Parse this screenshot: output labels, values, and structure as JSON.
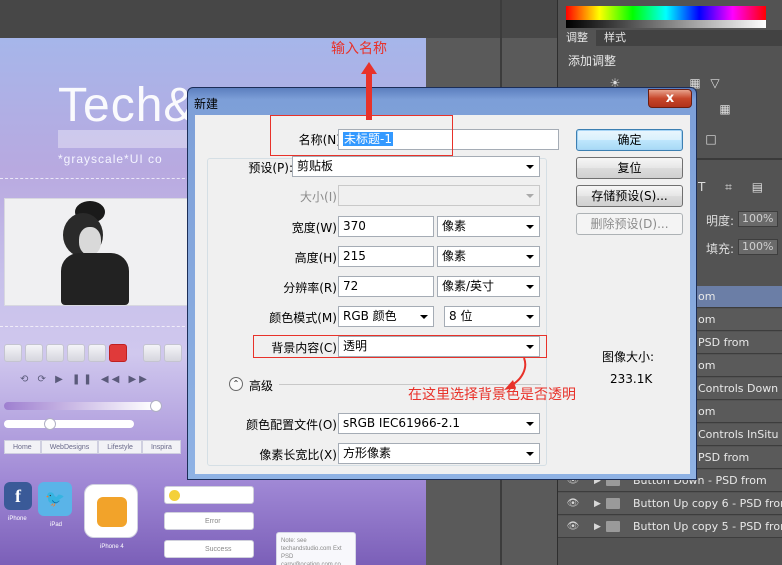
{
  "dialog": {
    "title": "新建",
    "close_glyph": "x",
    "fields": {
      "name": {
        "label": "名称(N):",
        "value": "未标题-1"
      },
      "preset": {
        "label": "预设(P):",
        "value": "剪贴板"
      },
      "size": {
        "label": "大小(I):",
        "value": ""
      },
      "width": {
        "label": "宽度(W):",
        "value": "370",
        "unit": "像素"
      },
      "height": {
        "label": "高度(H):",
        "value": "215",
        "unit": "像素"
      },
      "resolution": {
        "label": "分辨率(R):",
        "value": "72",
        "unit": "像素/英寸"
      },
      "color_mode": {
        "label": "颜色模式(M):",
        "value": "RGB 颜色",
        "depth": "8 位"
      },
      "background": {
        "label": "背景内容(C):",
        "value": "透明"
      },
      "color_profile": {
        "label": "颜色配置文件(O):",
        "value": "sRGB IEC61966-2.1"
      },
      "pixel_aspect": {
        "label": "像素长宽比(X):",
        "value": "方形像素"
      }
    },
    "advanced_label": "高级",
    "buttons": {
      "ok": "确定",
      "reset": "复位",
      "save_preset": "存储预设(S)...",
      "delete_preset": "删除预设(D)..."
    },
    "image_size": {
      "label": "图像大小:",
      "value": "233.1K"
    }
  },
  "annotations": {
    "name_hint": "输入名称",
    "background_hint": "在这里选择背景色是否透明",
    "color": "#e8322a"
  },
  "right_panel": {
    "tabs": [
      "调整",
      "样式"
    ],
    "adjust_title": "添加调整",
    "opacity_label": "明度:",
    "opacity_value": "100%",
    "fill_label": "填充:",
    "fill_value": "100%",
    "layers": [
      {
        "name": "om",
        "selected": true,
        "eye": false,
        "folder": false,
        "short": true
      },
      {
        "name": "om",
        "selected": false,
        "eye": false,
        "folder": false,
        "short": true
      },
      {
        "name": "PSD from",
        "selected": false,
        "eye": false,
        "folder": false,
        "short": true
      },
      {
        "name": "om",
        "selected": false,
        "eye": false,
        "folder": false,
        "short": true
      },
      {
        "name": "Controls Down",
        "selected": false,
        "eye": false,
        "folder": false,
        "short": true
      },
      {
        "name": "om",
        "selected": false,
        "eye": false,
        "folder": false,
        "short": true
      },
      {
        "name": "Controls InSitu",
        "selected": false,
        "eye": false,
        "folder": false,
        "short": true
      },
      {
        "name": "PSD from",
        "selected": false,
        "eye": false,
        "folder": false,
        "short": true
      },
      {
        "name": "Button Down - PSD from",
        "selected": false,
        "eye": true,
        "folder": true,
        "short": false
      },
      {
        "name": "Button Up copy 6 - PSD from",
        "selected": false,
        "eye": true,
        "folder": true,
        "short": false
      },
      {
        "name": "Button Up copy 5 - PSD from",
        "selected": false,
        "eye": true,
        "folder": true,
        "short": false
      }
    ]
  },
  "canvas": {
    "brand_text": "Tech&",
    "tagline": "*grayscale*UI co",
    "nav_tabs": [
      "Home",
      "WebDesigns",
      "Lifestyle",
      "Inspira"
    ],
    "app_labels": {
      "fb": "f",
      "fb_caption": "iPhone",
      "tw_caption": "iPad",
      "rss_caption": "iPhone 4"
    },
    "messages": [
      "Error",
      "Success"
    ],
    "note_text": "Note: see techandstudio.com Ext PSD carry@ocation.com.co"
  }
}
